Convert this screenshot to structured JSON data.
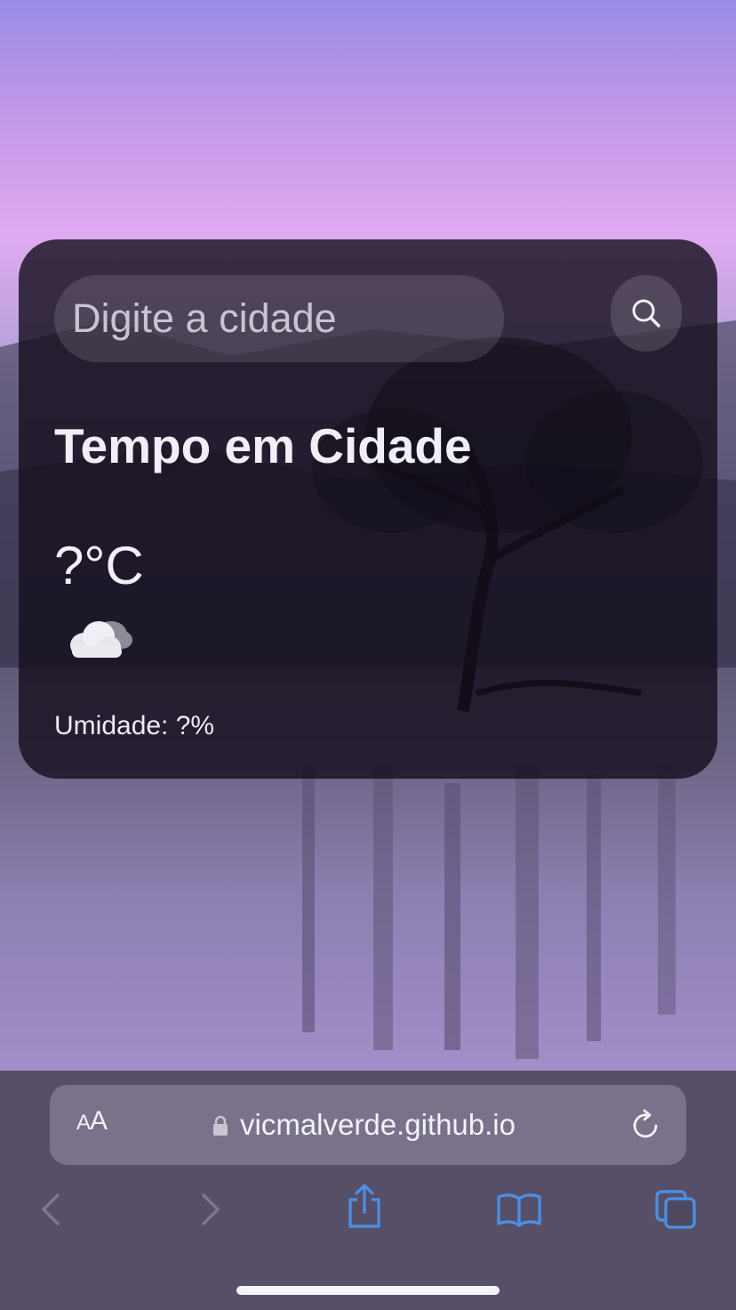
{
  "weather_card": {
    "search_placeholder": "Digite a cidade",
    "search_icon": "search-icon",
    "city_title": "Tempo em Cidade",
    "temperature": "?°C",
    "weather_icon": "cloud-icon",
    "humidity": "Umidade: ?%"
  },
  "browser": {
    "aa_small": "A",
    "aa_large": "A",
    "url": "vicmalverde.github.io",
    "icons": [
      "lock-icon",
      "reload-icon",
      "back-icon",
      "forward-icon",
      "share-icon",
      "bookmarks-icon",
      "tabs-icon"
    ]
  },
  "colors": {
    "card_background": "#16101e",
    "toolbar_accent": "#4a90e8",
    "toolbar_disabled": "#7c7890"
  }
}
